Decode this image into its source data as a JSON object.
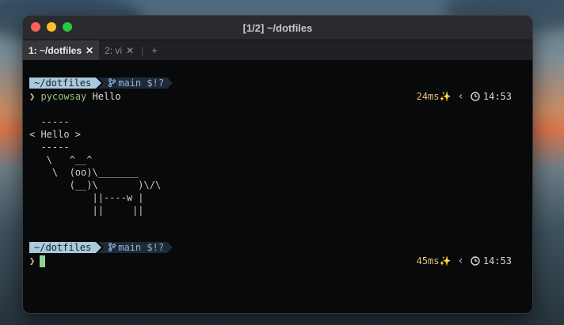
{
  "window": {
    "title": "[1/2] ~/dotfiles"
  },
  "tabs": [
    {
      "label": "1: ~/dotfiles",
      "close": "✕"
    },
    {
      "label": "2: vi",
      "close": "✕"
    }
  ],
  "new_tab": "+",
  "prompt1": {
    "dir": "~/dotfiles",
    "git": "main $!?",
    "symbol": "❯",
    "command": "pycowsay",
    "argument": "Hello",
    "duration": "24ms✨",
    "time": "14:53"
  },
  "output": [
    "  -----",
    "< Hello >",
    "  -----",
    "   \\   ^__^",
    "    \\  (oo)\\_______",
    "       (__)\\       )\\/\\",
    "           ||----w |",
    "           ||     ||"
  ],
  "prompt2": {
    "dir": "~/dotfiles",
    "git": "main $!?",
    "symbol": "❯",
    "duration": "45ms✨",
    "time": "14:53"
  }
}
